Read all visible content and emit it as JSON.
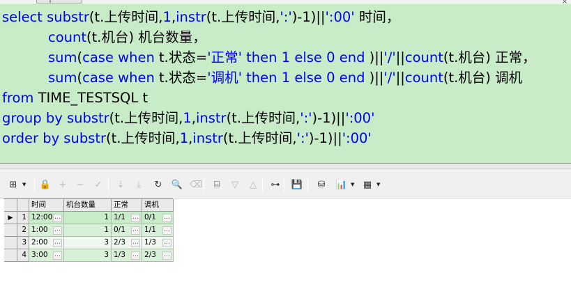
{
  "sql": {
    "lines": [
      {
        "indent": false,
        "tokens": [
          {
            "t": "select substr",
            "c": "kw"
          },
          {
            "t": "(t.上传时间,",
            "c": "pl"
          },
          {
            "t": "1",
            "c": "num"
          },
          {
            "t": ",",
            "c": "pl"
          },
          {
            "t": "instr",
            "c": "fn"
          },
          {
            "t": "(t.上传时间,",
            "c": "pl"
          },
          {
            "t": "':'",
            "c": "str"
          },
          {
            "t": ")-1)||",
            "c": "pl"
          },
          {
            "t": "':00'",
            "c": "str"
          },
          {
            "t": " 时间，",
            "c": "pl"
          }
        ]
      },
      {
        "indent": true,
        "tokens": [
          {
            "t": "count",
            "c": "fn"
          },
          {
            "t": "(t.机台) 机台数量，",
            "c": "pl"
          }
        ]
      },
      {
        "indent": true,
        "tokens": [
          {
            "t": "sum",
            "c": "fn"
          },
          {
            "t": "(",
            "c": "pl"
          },
          {
            "t": "case when ",
            "c": "kw"
          },
          {
            "t": "t.状态=",
            "c": "pl"
          },
          {
            "t": "'正常'",
            "c": "str"
          },
          {
            "t": " then ",
            "c": "kw"
          },
          {
            "t": "1",
            "c": "num"
          },
          {
            "t": " else ",
            "c": "kw"
          },
          {
            "t": "0",
            "c": "num"
          },
          {
            "t": " end ",
            "c": "kw"
          },
          {
            "t": ")||",
            "c": "pl"
          },
          {
            "t": "'/'",
            "c": "str"
          },
          {
            "t": "||",
            "c": "pl"
          },
          {
            "t": "count",
            "c": "fn"
          },
          {
            "t": "(t.机台) 正常，",
            "c": "pl"
          }
        ]
      },
      {
        "indent": true,
        "tokens": [
          {
            "t": "sum",
            "c": "fn"
          },
          {
            "t": "(",
            "c": "pl"
          },
          {
            "t": "case when ",
            "c": "kw"
          },
          {
            "t": "t.状态=",
            "c": "pl"
          },
          {
            "t": "'调机'",
            "c": "str"
          },
          {
            "t": " then ",
            "c": "kw"
          },
          {
            "t": "1",
            "c": "num"
          },
          {
            "t": " else ",
            "c": "kw"
          },
          {
            "t": "0",
            "c": "num"
          },
          {
            "t": " end ",
            "c": "kw"
          },
          {
            "t": ")||",
            "c": "pl"
          },
          {
            "t": "'/'",
            "c": "str"
          },
          {
            "t": "||",
            "c": "pl"
          },
          {
            "t": "count",
            "c": "fn"
          },
          {
            "t": "(t.机台) 调机",
            "c": "pl"
          }
        ]
      },
      {
        "indent": false,
        "tokens": [
          {
            "t": "from ",
            "c": "kw"
          },
          {
            "t": "TIME_TESTSQL t",
            "c": "pl"
          }
        ]
      },
      {
        "indent": false,
        "tokens": [
          {
            "t": "group by substr",
            "c": "kw"
          },
          {
            "t": "(t.上传时间,",
            "c": "pl"
          },
          {
            "t": "1",
            "c": "num"
          },
          {
            "t": ",",
            "c": "pl"
          },
          {
            "t": "instr",
            "c": "fn"
          },
          {
            "t": "(t.上传时间,",
            "c": "pl"
          },
          {
            "t": "':'",
            "c": "str"
          },
          {
            "t": ")-1)||",
            "c": "pl"
          },
          {
            "t": "':00'",
            "c": "str"
          }
        ]
      },
      {
        "indent": false,
        "tokens": [
          {
            "t": "order by substr",
            "c": "kw"
          },
          {
            "t": "(t.上传时间,",
            "c": "pl"
          },
          {
            "t": "1",
            "c": "num"
          },
          {
            "t": ",",
            "c": "pl"
          },
          {
            "t": "instr",
            "c": "fn"
          },
          {
            "t": "(t.上传时间,",
            "c": "pl"
          },
          {
            "t": "':'",
            "c": "str"
          },
          {
            "t": ")-1)||",
            "c": "pl"
          },
          {
            "t": "':00'",
            "c": "str"
          }
        ]
      }
    ]
  },
  "toolbar": {
    "buttons": [
      {
        "name": "grid-layout-button",
        "glyph": "⊞",
        "disabled": false,
        "dropdown": true
      },
      {
        "name": "lock-button",
        "glyph": "🔒",
        "disabled": false
      },
      {
        "name": "add-record-button",
        "glyph": "+",
        "disabled": true
      },
      {
        "name": "delete-record-button",
        "glyph": "−",
        "disabled": true
      },
      {
        "name": "post-changes-button",
        "glyph": "✓",
        "disabled": true
      },
      {
        "name": "fetch-next-button",
        "glyph": "⇣",
        "disabled": true
      },
      {
        "name": "fetch-last-button",
        "glyph": "⤓",
        "disabled": true
      },
      {
        "name": "refresh-button",
        "glyph": "↻",
        "disabled": false
      },
      {
        "name": "find-button",
        "glyph": "🔍",
        "disabled": false
      },
      {
        "name": "clear-button",
        "glyph": "⌫",
        "disabled": true
      },
      {
        "name": "query-by-example-button",
        "glyph": "⌸",
        "disabled": false
      },
      {
        "name": "next-record-button",
        "glyph": "▽",
        "disabled": true
      },
      {
        "name": "previous-record-button",
        "glyph": "△",
        "disabled": true
      },
      {
        "name": "export-tree-button",
        "glyph": "⊶",
        "disabled": false
      },
      {
        "name": "save-button",
        "glyph": "💾",
        "disabled": false
      },
      {
        "name": "database-button",
        "glyph": "⛁",
        "disabled": false,
        "dropdown": false
      },
      {
        "name": "chart-button",
        "glyph": "📊",
        "disabled": false,
        "dropdown": true
      },
      {
        "name": "table-view-button",
        "glyph": "▦",
        "disabled": false,
        "dropdown": true
      }
    ]
  },
  "grid": {
    "columns": [
      "时间",
      "机台数量",
      "正常",
      "调机"
    ],
    "rows": [
      {
        "num": "1",
        "time": "12:00",
        "count": "1",
        "normal": "1/1",
        "adjust": "0/1"
      },
      {
        "num": "2",
        "time": "1:00",
        "count": "1",
        "normal": "0/1",
        "adjust": "1/1"
      },
      {
        "num": "3",
        "time": "2:00",
        "count": "3",
        "normal": "2/3",
        "adjust": "1/3"
      },
      {
        "num": "4",
        "time": "3:00",
        "count": "3",
        "normal": "1/3",
        "adjust": "2/3"
      }
    ],
    "current_row_marker": "▶",
    "ellipsis": "…"
  },
  "colors": {
    "editor_bg": "#c8ecc8",
    "keyword": "#0000ff",
    "plain": "#000000"
  }
}
